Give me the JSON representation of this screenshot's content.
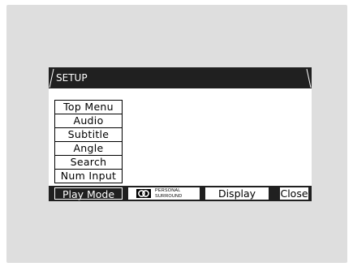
{
  "osd": {
    "title": "SETUP",
    "menu_items": [
      {
        "label": "Top Menu"
      },
      {
        "label": "Audio"
      },
      {
        "label": "Subtitle"
      },
      {
        "label": "Angle"
      },
      {
        "label": "Search"
      },
      {
        "label": "Num Input"
      }
    ],
    "bottom_buttons": {
      "play_mode": "Play Mode",
      "surround_line1": "PERSONAL",
      "surround_line2": "SURROUND",
      "display": "Display",
      "close": "Close"
    }
  },
  "colors": {
    "screen_background": "#dedede",
    "bar_dark": "#202020",
    "osd_background": "#ffffff"
  }
}
